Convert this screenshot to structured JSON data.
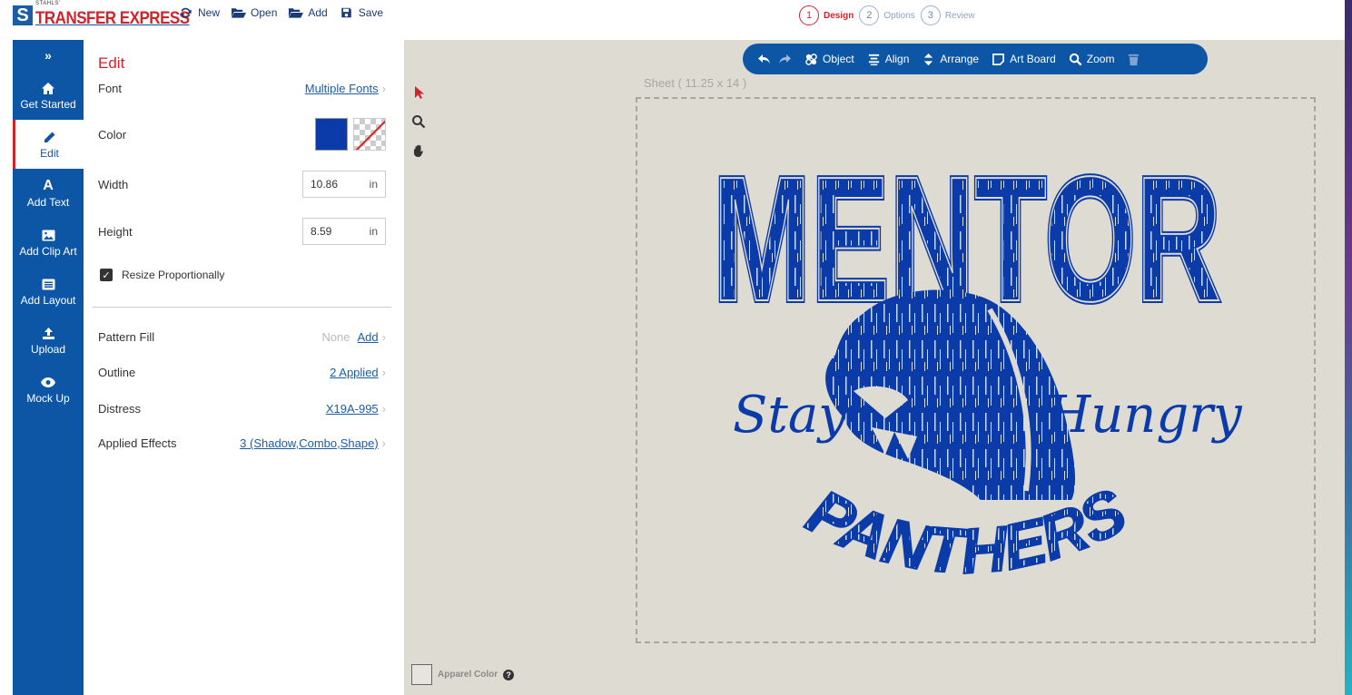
{
  "brand": {
    "small_text": "STAHLS'",
    "name": "TRANSFER EXPRESS"
  },
  "file_menu": [
    {
      "label": "New",
      "icon": "refresh-icon"
    },
    {
      "label": "Open",
      "icon": "folder-open-icon"
    },
    {
      "label": "Add",
      "icon": "folder-open-icon"
    },
    {
      "label": "Save",
      "icon": "save-icon"
    }
  ],
  "steps": [
    {
      "num": "1",
      "label": "Design",
      "active": true
    },
    {
      "num": "2",
      "label": "Options",
      "active": false
    },
    {
      "num": "3",
      "label": "Review",
      "active": false
    }
  ],
  "nav": {
    "toggle": "»",
    "items": [
      {
        "label": "Get Started",
        "icon": "home-icon"
      },
      {
        "label": "Edit",
        "icon": "pencil-icon",
        "active": true
      },
      {
        "label": "Add Text",
        "icon": "text-a-icon"
      },
      {
        "label": "Add Clip Art",
        "icon": "image-icon"
      },
      {
        "label": "Add Layout",
        "icon": "layout-icon"
      },
      {
        "label": "Upload",
        "icon": "upload-icon"
      },
      {
        "label": "Mock Up",
        "icon": "eye-icon"
      }
    ]
  },
  "edit": {
    "title": "Edit",
    "font_label": "Font",
    "font_value": "Multiple Fonts",
    "color_label": "Color",
    "color_hex": "#0b3aa9",
    "width_label": "Width",
    "width_value": "10.86",
    "height_label": "Height",
    "height_value": "8.59",
    "unit": "in",
    "resize_label": "Resize Proportionally",
    "resize_checked": true,
    "pattern_label": "Pattern Fill",
    "pattern_value": "None",
    "pattern_add": "Add",
    "outline_label": "Outline",
    "outline_value": "2 Applied",
    "distress_label": "Distress",
    "distress_value": "X19A-995",
    "effects_label": "Applied Effects",
    "effects_value": "3 (Shadow,Combo,Shape)"
  },
  "toolbar": {
    "object": "Object",
    "align": "Align",
    "arrange": "Arrange",
    "artboard": "Art Board",
    "zoom": "Zoom"
  },
  "canvas": {
    "sheet_label": "Sheet ( 11.25 x 14 )",
    "apparel_label": "Apparel Color",
    "help": "?"
  },
  "artwork": {
    "top_word": "MENTOR",
    "left_script": "Stay",
    "right_script": "Hungry",
    "bottom_word": "PANTHERS",
    "ink_color": "#0b3aa9"
  }
}
